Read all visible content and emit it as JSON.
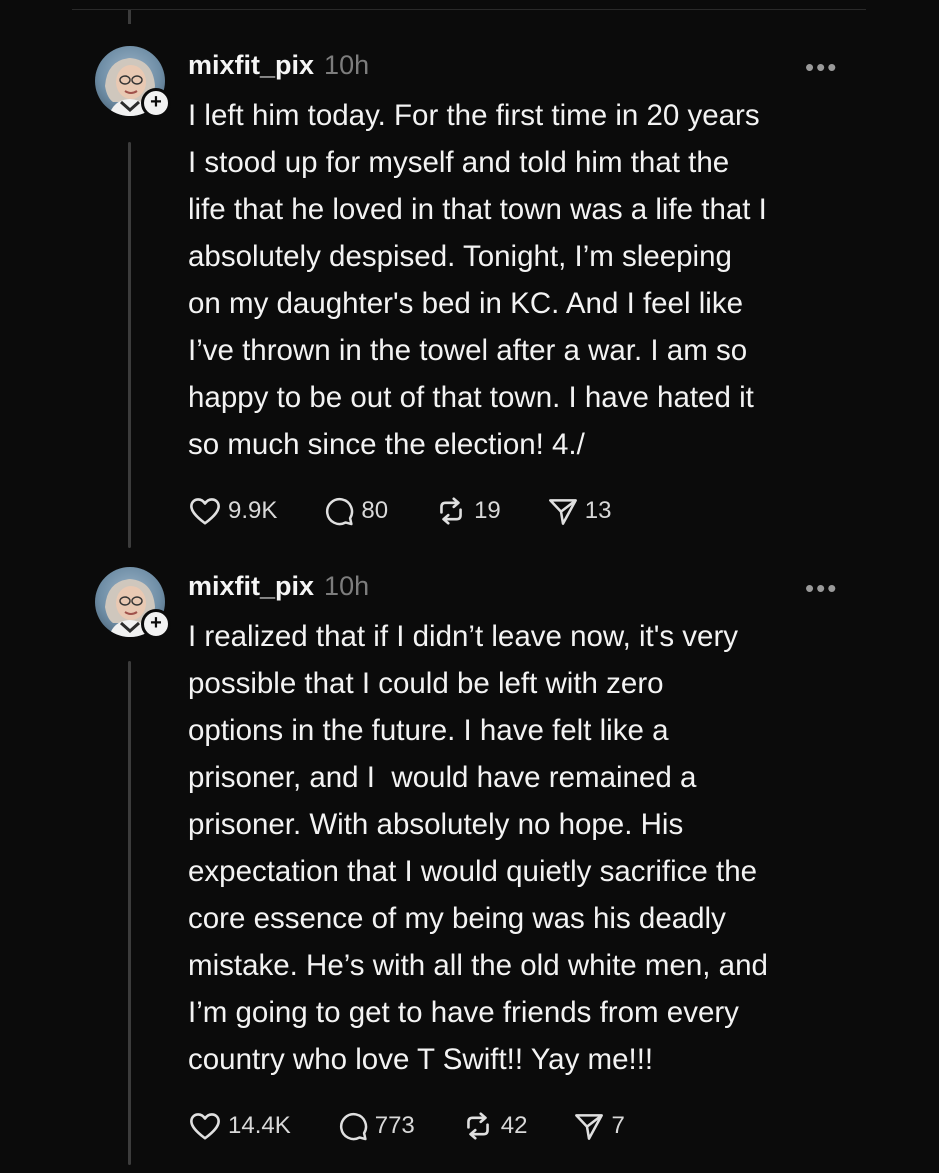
{
  "posts": [
    {
      "username": "mixfit_pix",
      "time": "10h",
      "text": "I left him today. For the first time in 20 years\nI stood up for myself and told him that the\nlife that he loved in that town was a life that I\nabsolutely despised. Tonight, I’m sleeping\non my daughter's bed in KC. And I feel like\nI’ve thrown in the towel after a war. I am so\nhappy to be out of that town. I have hated it\nso much since the election! 4./",
      "likes": "9.9K",
      "replies": "80",
      "reposts": "19",
      "shares": "13"
    },
    {
      "username": "mixfit_pix",
      "time": "10h",
      "text": "I realized that if I didn’t leave now, it's very\npossible that I could be left with zero\noptions in the future. I have felt like a\nprisoner, and I  would have remained a\nprisoner. With absolutely no hope. His\nexpectation that I would quietly sacrifice the\ncore essence of my being was his deadly\nmistake. He’s with all the old white men, and\nI’m going to get to have friends from every\ncountry who love T Swift!! Yay me!!!",
      "likes": "14.4K",
      "replies": "773",
      "reposts": "42",
      "shares": "7"
    }
  ],
  "icons": {
    "like": "heart-icon",
    "reply": "comment-icon",
    "repost": "repost-icon",
    "share": "send-icon",
    "more": "more-dots-icon",
    "follow": "plus-icon"
  },
  "more_label": "•••",
  "follow_label": "+",
  "colors": {
    "background": "#0b0b0b",
    "text": "#f3f3f3",
    "muted": "#7d7d7d",
    "thread_line": "#3c3c3c"
  }
}
